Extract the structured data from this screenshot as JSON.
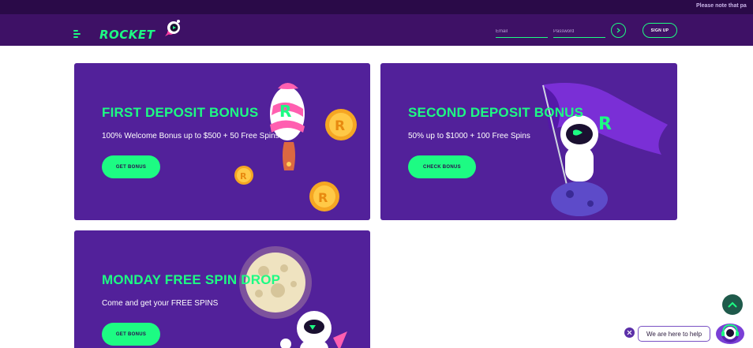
{
  "ticker": {
    "text": "Please note that pa"
  },
  "header": {
    "logo_text": "ROCKET",
    "email_placeholder": "Email",
    "password_placeholder": "Password",
    "signup_label": "SIGN UP"
  },
  "promos": [
    {
      "title": "FIRST DEPOSIT BONUS",
      "subtitle": "100% Welcome Bonus up to $500 + 50 Free Spins",
      "button": "GET BONUS"
    },
    {
      "title": "SECOND DEPOSIT BONUS",
      "subtitle": "50% up to $1000 + 100 Free Spins",
      "button": "CHECK BONUS"
    },
    {
      "title": "MONDAY FREE SPIN DROP",
      "subtitle": "Come and get your FREE SPINS",
      "button": "GET BONUS"
    }
  ],
  "chat": {
    "bubble_text": "We are here to help"
  },
  "colors": {
    "accent": "#1dfb83",
    "header_bg": "#3e1166",
    "card_bg": "#52219a",
    "ticker_bg": "#2a0a48"
  },
  "icons": [
    "hamburger-menu-icon",
    "rocket-logo-icon",
    "arrow-right-icon",
    "chevron-up-icon",
    "close-icon",
    "support-agent-icon"
  ]
}
